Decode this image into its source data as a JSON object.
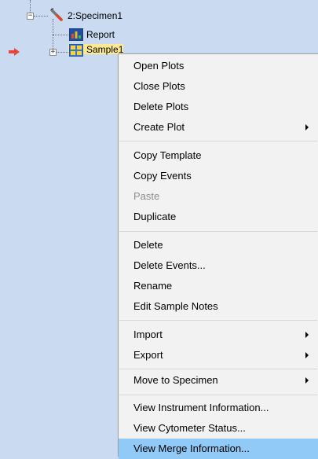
{
  "tree": {
    "specimen_label": "2:Specimen1",
    "report_label": "Report",
    "sample_label": "Sample1",
    "specimen_expander": "−",
    "sample_expander": "+"
  },
  "menu": {
    "items": [
      {
        "label": "Open Plots",
        "enabled": true
      },
      {
        "label": "Close Plots",
        "enabled": true
      },
      {
        "label": "Delete Plots",
        "enabled": true
      },
      {
        "label": "Create Plot",
        "enabled": true,
        "submenu": true
      },
      {
        "label": "Copy Template",
        "enabled": true
      },
      {
        "label": "Copy Events",
        "enabled": true
      },
      {
        "label": "Paste",
        "enabled": false
      },
      {
        "label": "Duplicate",
        "enabled": true
      },
      {
        "label": "Delete",
        "enabled": true
      },
      {
        "label": "Delete Events...",
        "enabled": true
      },
      {
        "label": "Rename",
        "enabled": true
      },
      {
        "label": "Edit Sample Notes",
        "enabled": true
      },
      {
        "label": "Import",
        "enabled": true,
        "submenu": true
      },
      {
        "label": "Export",
        "enabled": true,
        "submenu": true
      },
      {
        "label": "Move to Specimen",
        "enabled": true,
        "submenu": true
      },
      {
        "label": "View Instrument Information...",
        "enabled": true
      },
      {
        "label": "View Cytometer Status...",
        "enabled": true
      },
      {
        "label": "View Merge Information...",
        "enabled": true,
        "highlighted": true
      }
    ]
  },
  "colors": {
    "panel_background": "#c9daf1",
    "menu_background": "#f2f2f2",
    "highlight": "#91c9f7",
    "selected_node": "#fce992",
    "pointer_arrow": "#e8463a"
  }
}
